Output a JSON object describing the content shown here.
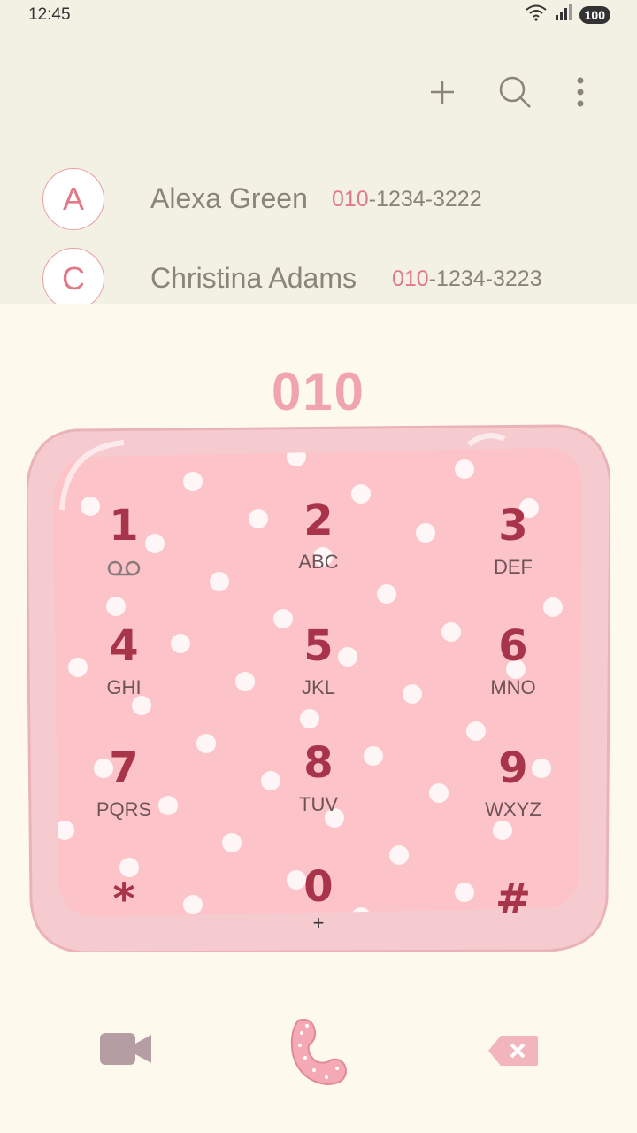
{
  "status": {
    "time": "12:45",
    "battery": "100"
  },
  "toolbar": {
    "icons": [
      "plus-icon",
      "search-icon",
      "more-vert-icon"
    ]
  },
  "contacts": [
    {
      "initial": "A",
      "name": "Alexa Green",
      "number_match": "010",
      "number_rest": "-1234-3222"
    },
    {
      "initial": "C",
      "name": "Christina Adams",
      "number_match": "010",
      "number_rest": "-1234-3223"
    }
  ],
  "dialer": {
    "typed": "010"
  },
  "keys": [
    {
      "digit": "1",
      "letters": ""
    },
    {
      "digit": "2",
      "letters": "ABC"
    },
    {
      "digit": "3",
      "letters": "DEF"
    },
    {
      "digit": "4",
      "letters": "GHI"
    },
    {
      "digit": "5",
      "letters": "JKL"
    },
    {
      "digit": "6",
      "letters": "MNO"
    },
    {
      "digit": "7",
      "letters": "PQRS"
    },
    {
      "digit": "8",
      "letters": "TUV"
    },
    {
      "digit": "9",
      "letters": "WXYZ"
    },
    {
      "digit": "*",
      "letters": ""
    },
    {
      "digit": "0",
      "letters": "+"
    },
    {
      "digit": "#",
      "letters": ""
    }
  ],
  "bottom": {
    "icons": [
      "video-call-icon",
      "call-icon",
      "backspace-icon"
    ]
  },
  "colors": {
    "accent": "#e07a88",
    "keypad": "#fcc4c8",
    "digit": "#a8344a",
    "frame": "#f6cbd0"
  }
}
